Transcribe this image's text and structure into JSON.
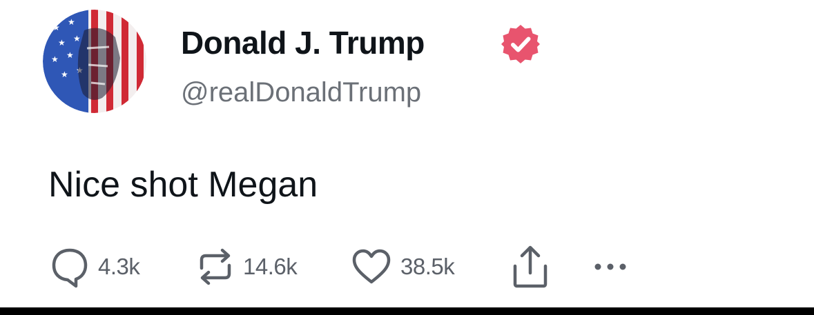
{
  "post": {
    "author": {
      "display_name": "Donald J. Trump",
      "handle": "@realDonaldTrump",
      "verified": true,
      "verified_badge_color": "#e8546e",
      "avatar_icon": "flag-portrait-avatar"
    },
    "text": "Nice shot Megan",
    "actions": {
      "replies": {
        "icon": "reply-icon",
        "count": "4.3k"
      },
      "reposts": {
        "icon": "repost-icon",
        "count": "14.6k"
      },
      "likes": {
        "icon": "heart-icon",
        "count": "38.5k"
      },
      "share": {
        "icon": "share-icon"
      },
      "more": {
        "icon": "more-icon"
      }
    }
  },
  "colors": {
    "text_primary": "#0f1419",
    "text_secondary": "#6b7077",
    "icon_gray": "#5b6068",
    "background": "#ffffff"
  }
}
